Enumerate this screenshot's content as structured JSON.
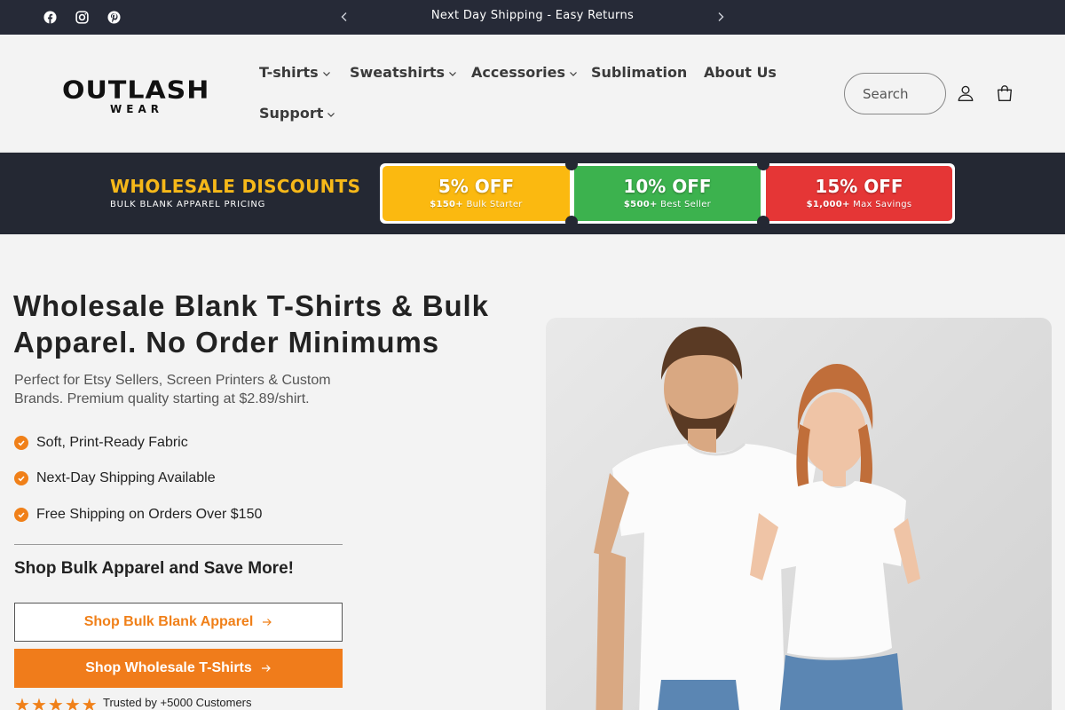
{
  "topbar": {
    "social": [
      {
        "name": "facebook-icon"
      },
      {
        "name": "instagram-icon"
      },
      {
        "name": "pinterest-icon"
      }
    ],
    "announcement": "Next Day Shipping - Easy Returns"
  },
  "header": {
    "logo": {
      "main": "OUTLASH",
      "sub": "WEAR"
    },
    "nav": [
      {
        "label": "T-shirts",
        "dropdown": true
      },
      {
        "label": "Sweatshirts",
        "dropdown": true
      },
      {
        "label": "Accessories",
        "dropdown": true
      },
      {
        "label": "Sublimation",
        "dropdown": false
      },
      {
        "label": "About Us",
        "dropdown": false
      },
      {
        "label": "Support",
        "dropdown": true
      }
    ],
    "search_label": "Search",
    "icons": [
      "account-icon",
      "cart-icon"
    ]
  },
  "banner": {
    "title": "WHOLESALE DISCOUNTS",
    "subtitle": "BULK BLANK APPAREL PRICING",
    "tiers": [
      {
        "pct": "5% OFF",
        "threshold": "$150+",
        "label": "Bulk Starter",
        "color": "#fbb910"
      },
      {
        "pct": "10% OFF",
        "threshold": "$500+",
        "label": "Best Seller",
        "color": "#3cb24e"
      },
      {
        "pct": "15% OFF",
        "threshold": "$1,000+",
        "label": "Max Savings",
        "color": "#e53636"
      }
    ]
  },
  "hero": {
    "title": "Wholesale Blank T-Shirts & Bulk Apparel. No Order Minimums",
    "description": "Perfect for Etsy Sellers, Screen Printers & Custom Brands. Premium quality starting at $2.89/shirt.",
    "features": [
      "Soft, Print-Ready Fabric",
      "Next-Day Shipping Available",
      "Free Shipping on Orders Over $150"
    ],
    "shop_heading": "Shop Bulk Apparel and Save More!",
    "buttons": {
      "primary_outline": "Shop Bulk Blank Apparel",
      "primary_fill": "Shop Wholesale T-Shirts"
    },
    "rating": 5,
    "trusted": "Trusted by +5000 Customers"
  },
  "colors": {
    "topbar_bg": "#262a37",
    "accent_orange": "#f08019",
    "banner_gold": "#f6b819"
  }
}
